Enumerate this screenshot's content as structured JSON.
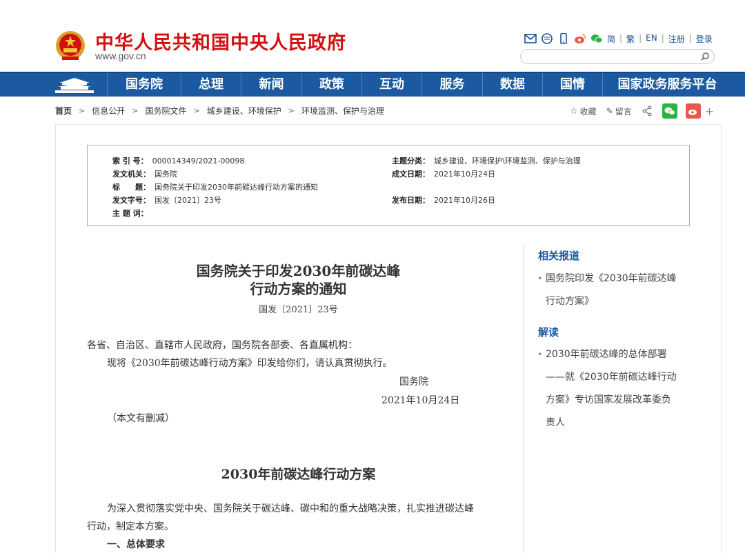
{
  "header": {
    "title": "中华人民共和国中央人民政府",
    "domain": "www.gov.cn",
    "lang_links": [
      "简",
      "繁",
      "EN",
      "注册",
      "登录"
    ],
    "search_placeholder": ""
  },
  "nav": {
    "items": [
      "国务院",
      "总理",
      "新闻",
      "政策",
      "互动",
      "服务",
      "数据",
      "国情",
      "国家政务服务平台"
    ]
  },
  "breadcrumb": [
    "首页",
    "信息公开",
    "国务院文件",
    "城乡建设、环境保护",
    "环境监测、保护与治理"
  ],
  "share": {
    "favorite": "收藏",
    "comment": "留言",
    "plus": "+"
  },
  "meta": {
    "index_label": "索 引 号：",
    "index_value": "000014349/2021-00098",
    "issuer_label": "发文机关：",
    "issuer_value": "国务院",
    "title_label": "标　　题：",
    "title_value": "国务院关于印发2030年前碳达峰行动方案的通知",
    "docno_label": "发文字号：",
    "docno_value": "国发〔2021〕23号",
    "subject_label": "主 题 词：",
    "subject_value": "",
    "category_label": "主题分类：",
    "category_value": "城乡建设、环境保护\\环境监测、保护与治理",
    "written_label": "成文日期：",
    "written_value": "2021年10月24日",
    "published_label": "发布日期：",
    "published_value": "2021年10月26日"
  },
  "article": {
    "title_line1": "国务院关于印发2030年前碳达峰",
    "title_line2": "行动方案的通知",
    "doc_number": "国发〔2021〕23号",
    "salutation": "各省、自治区、直辖市人民政府，国务院各部委、各直属机构：",
    "body1": "现将《2030年前碳达峰行动方案》印发给你们，请认真贯彻执行。",
    "signer": "国务院",
    "date": "2021年10月24日",
    "note": "（本文有删减）",
    "plan_title": "2030年前碳达峰行动方案",
    "plan_para1_line1": "为深入贯彻落实党中央、国务院关于碳达峰、碳中和的重大战略决策，扎实推进碳达峰",
    "plan_para1_line2": "行动，制定本方案。",
    "section1": "一、总体要求"
  },
  "sidebar": {
    "related_heading": "相关报道",
    "related_item_line1": "国务院印发《2030年前碳达峰",
    "related_item_line2": "行动方案》",
    "interpret_heading": "解读",
    "interpret_item_line1": "2030年前碳达峰的总体部署",
    "interpret_item_line2": "——就《2030年前碳达峰行动",
    "interpret_item_line3": "方案》专访国家发展改革委负",
    "interpret_item_line4": "责人"
  },
  "colors": {
    "brand_red": "#d40f10",
    "nav_blue": "#1b5aa0",
    "link_blue": "#1a4f95",
    "wechat_green": "#2ab340",
    "weibo_orange": "#e8594b"
  }
}
